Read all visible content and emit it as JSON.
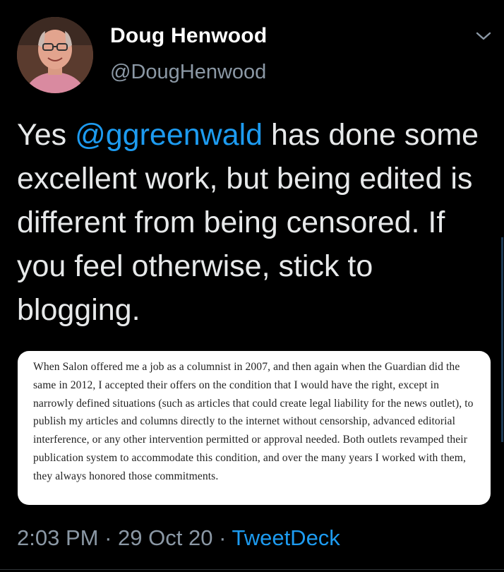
{
  "author": {
    "name": "Doug Henwood",
    "handle": "@DougHenwood",
    "avatar_icon": "profile-photo"
  },
  "tweet": {
    "text_before_mention": "Yes ",
    "mention": "@ggreenwald",
    "text_after_mention": " has done some excellent work, but being edited is different from being censored. If you feel otherwise, stick to blogging."
  },
  "attached_image": {
    "quoted_text": "When Salon offered me a job as a columnist in 2007, and then again when the Guardian did the same in 2012, I accepted their offers on the condition that I would have the right, except in narrowly defined situations (such as articles that could create legal liability for the news outlet), to publish my articles and columns directly to the internet without censorship, advanced editorial interference, or any other intervention permitted or approval needed. Both outlets revamped their publication system to accommodate this condition, and over the many years I worked with them, they always honored those commitments."
  },
  "meta": {
    "time": "2:03 PM",
    "separator": "·",
    "date": "29 Oct 20",
    "source": "TweetDeck"
  },
  "colors": {
    "background": "#000000",
    "link": "#1d9bf0",
    "secondary": "#8b98a5",
    "primary_text": "#e7e9ea"
  }
}
